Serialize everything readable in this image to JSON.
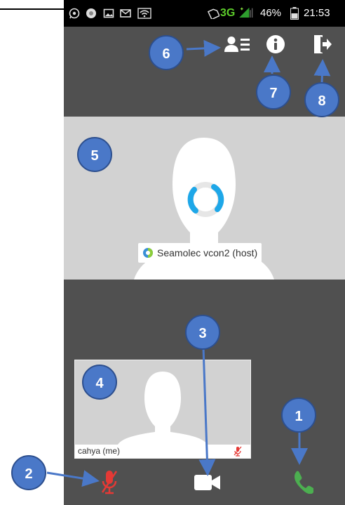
{
  "status_bar": {
    "network": "3G",
    "battery_percent": "46%",
    "time": "21:53",
    "icons": [
      "whatsapp-icon",
      "chrome-icon",
      "gallery-icon",
      "gmail-icon",
      "wifi-icon",
      "no-sim-icon",
      "signal-icon",
      "battery-icon"
    ]
  },
  "toolbar": {
    "icons": [
      "participants-icon",
      "info-icon",
      "exit-icon"
    ]
  },
  "host": {
    "name": "Seamolec vcon2 (host)",
    "icons": [
      "avatar-placeholder",
      "loading-spinner",
      "host-status-icon"
    ]
  },
  "self_view": {
    "name": "cahya (me)",
    "icons": [
      "avatar-placeholder",
      "mic-muted-icon"
    ]
  },
  "controls": {
    "icons": [
      "mic-muted-icon",
      "video-camera-icon",
      "phone-icon"
    ]
  },
  "annotations": [
    "1",
    "2",
    "3",
    "4",
    "5",
    "6",
    "7",
    "8"
  ],
  "colors": {
    "annotation_fill": "#4a78c8",
    "muted_red": "#e53935",
    "call_green": "#4caf50",
    "spinner_blue": "#1ea7e8"
  }
}
